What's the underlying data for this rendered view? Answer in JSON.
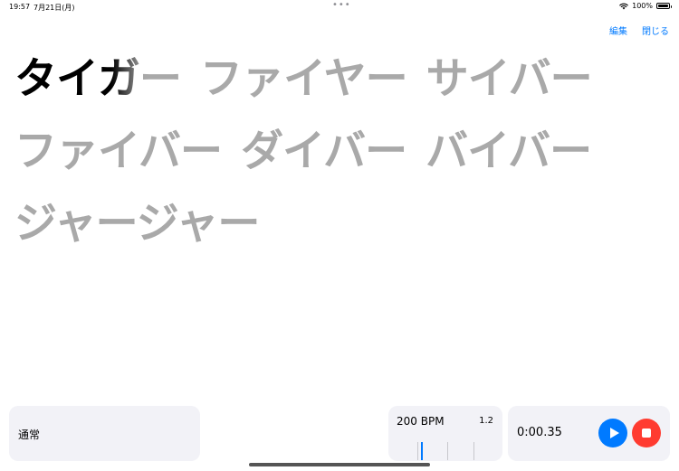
{
  "status_bar": {
    "time": "19:57",
    "date": "7月21日(月)",
    "multitask_dots": "•••",
    "battery_percent": "100%",
    "battery_level": 1.0
  },
  "nav": {
    "edit_label": "編集",
    "close_label": "閉じる"
  },
  "lyrics": {
    "lines": [
      [
        "タイガー",
        "ファイヤー",
        "サイバー"
      ],
      [
        "ファイバー",
        "ダイバー",
        "バイバー"
      ],
      [
        "ジャージャー"
      ]
    ],
    "active_word": "タイガー",
    "active_progress": 0.68
  },
  "mode": {
    "label": "通常"
  },
  "tempo": {
    "bpm_label": "200 BPM",
    "rate_label": "1.2",
    "beat_count": 4,
    "current_beat": 1
  },
  "transport": {
    "elapsed": "0:00.35",
    "play_icon": "play-icon",
    "stop_icon": "stop-icon"
  },
  "colors": {
    "accent": "#007aff",
    "stop": "#ff3b30",
    "panel_bg": "#f2f2f7",
    "lyric_inactive": "#a9a9a9",
    "lyric_active": "#000000"
  }
}
